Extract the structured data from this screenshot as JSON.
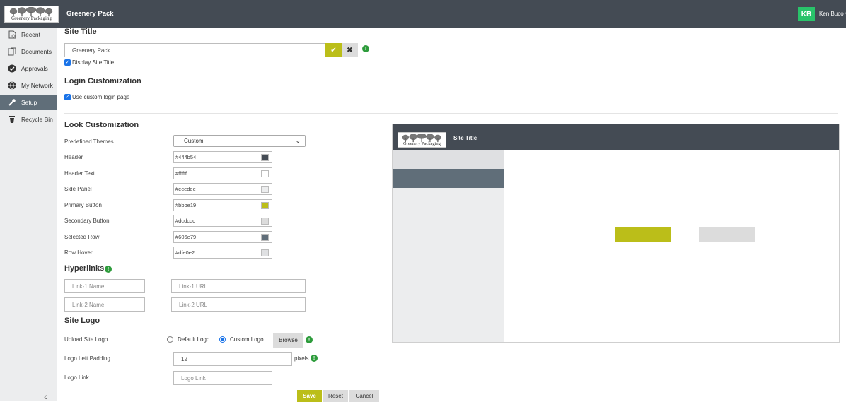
{
  "header": {
    "logo_text": "Greenery Packaging",
    "app_title": "Greenery Pack",
    "avatar_initials": "KB",
    "user_name": "Ken Buco",
    "avatar_color": "#29c36a"
  },
  "sidebar": {
    "items": [
      {
        "label": "Recent",
        "icon": "recent-doc-icon"
      },
      {
        "label": "Documents",
        "icon": "documents-icon"
      },
      {
        "label": "Approvals",
        "icon": "approvals-check-icon"
      },
      {
        "label": "My Network",
        "icon": "network-globe-icon"
      },
      {
        "label": "Setup",
        "icon": "setup-wrench-icon",
        "selected": true
      },
      {
        "label": "Recycle Bin",
        "icon": "recycle-bin-icon"
      }
    ],
    "collapse_icon": "chevron-left-icon"
  },
  "site_title": {
    "heading": "Site Title",
    "value": "Greenery Pack",
    "display_label": "Display Site Title",
    "display_checked": true
  },
  "login": {
    "heading": "Login Customization",
    "custom_label": "Use custom login page",
    "custom_checked": true
  },
  "look": {
    "heading": "Look Customization",
    "theme_label": "Predefined Themes",
    "theme_value": "Custom",
    "colors": [
      {
        "label": "Header",
        "value": "#444b54"
      },
      {
        "label": "Header Text",
        "value": "#ffffff"
      },
      {
        "label": "Side Panel",
        "value": "#ecedee"
      },
      {
        "label": "Primary Button",
        "value": "#bbbe19"
      },
      {
        "label": "Secondary Button",
        "value": "#dcdcdc"
      },
      {
        "label": "Selected Row",
        "value": "#606e79"
      },
      {
        "label": "Row Hover",
        "value": "#dfe0e2"
      }
    ]
  },
  "hyperlinks": {
    "heading": "Hyperlinks",
    "link1_name_placeholder": "Link-1 Name",
    "link1_url_placeholder": "Link-1 URL",
    "link2_name_placeholder": "Link-2 Name",
    "link2_url_placeholder": "Link-2 URL"
  },
  "site_logo": {
    "heading": "Site Logo",
    "upload_label": "Upload Site Logo",
    "default_logo": "Default Logo",
    "custom_logo": "Custom Logo",
    "browse": "Browse",
    "padding_label": "Logo Left Padding",
    "padding_value": "12",
    "padding_unit": "pixels",
    "link_label": "Logo Link",
    "link_placeholder": "Logo Link"
  },
  "actions": {
    "save": "Save",
    "reset": "Reset",
    "cancel": "Cancel"
  },
  "preview": {
    "logo_text": "Greenery Packaging",
    "title": "Site Title"
  }
}
